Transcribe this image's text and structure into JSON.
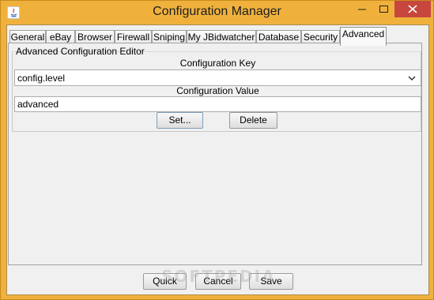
{
  "window": {
    "title": "Configuration Manager",
    "accent_color": "#f0b13c",
    "close_color": "#c7463e"
  },
  "tabs": [
    {
      "label": "General",
      "active": false
    },
    {
      "label": "eBay",
      "active": false
    },
    {
      "label": "Browser",
      "active": false
    },
    {
      "label": "Firewall",
      "active": false
    },
    {
      "label": "Sniping",
      "active": false
    },
    {
      "label": "My JBidwatcher",
      "active": false
    },
    {
      "label": "Database",
      "active": false
    },
    {
      "label": "Security",
      "active": false
    },
    {
      "label": "Advanced",
      "active": true
    }
  ],
  "editor": {
    "group_title": "Advanced Configuration Editor",
    "key_label": "Configuration Key",
    "key_value": "config.level",
    "value_label": "Configuration Value",
    "value_value": "advanced",
    "set_label": "Set...",
    "delete_label": "Delete"
  },
  "footer": {
    "quick_label": "Quick",
    "cancel_label": "Cancel",
    "save_label": "Save"
  },
  "watermark": "SOFTPEDIA"
}
